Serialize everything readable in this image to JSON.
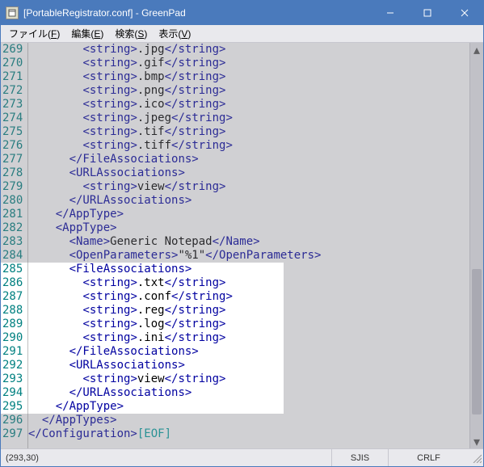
{
  "window": {
    "title": "[PortableRegistrator.conf] - GreenPad"
  },
  "menu": {
    "file": "ファイル(F)",
    "edit": "編集(E)",
    "search": "検索(S)",
    "view": "表示(V)"
  },
  "status": {
    "pos": "(293,30)",
    "encoding": "SJIS",
    "eol": "CRLF"
  },
  "highlight": {
    "startLine": 285,
    "endLine": 295
  },
  "lines": [
    {
      "n": 269,
      "indent": 8,
      "pre": "<string>",
      "mid": ".jpg",
      "post": "</string>"
    },
    {
      "n": 270,
      "indent": 8,
      "pre": "<string>",
      "mid": ".gif",
      "post": "</string>"
    },
    {
      "n": 271,
      "indent": 8,
      "pre": "<string>",
      "mid": ".bmp",
      "post": "</string>"
    },
    {
      "n": 272,
      "indent": 8,
      "pre": "<string>",
      "mid": ".png",
      "post": "</string>"
    },
    {
      "n": 273,
      "indent": 8,
      "pre": "<string>",
      "mid": ".ico",
      "post": "</string>"
    },
    {
      "n": 274,
      "indent": 8,
      "pre": "<string>",
      "mid": ".jpeg",
      "post": "</string>"
    },
    {
      "n": 275,
      "indent": 8,
      "pre": "<string>",
      "mid": ".tif",
      "post": "</string>"
    },
    {
      "n": 276,
      "indent": 8,
      "pre": "<string>",
      "mid": ".tiff",
      "post": "</string>"
    },
    {
      "n": 277,
      "indent": 6,
      "pre": "</FileAssociations>",
      "mid": "",
      "post": ""
    },
    {
      "n": 278,
      "indent": 6,
      "pre": "<URLAssociations>",
      "mid": "",
      "post": ""
    },
    {
      "n": 279,
      "indent": 8,
      "pre": "<string>",
      "mid": "view",
      "post": "</string>"
    },
    {
      "n": 280,
      "indent": 6,
      "pre": "</URLAssociations>",
      "mid": "",
      "post": ""
    },
    {
      "n": 281,
      "indent": 4,
      "pre": "</AppType>",
      "mid": "",
      "post": ""
    },
    {
      "n": 282,
      "indent": 4,
      "pre": "<AppType>",
      "mid": "",
      "post": ""
    },
    {
      "n": 283,
      "indent": 6,
      "pre": "<Name>",
      "mid": "Generic Notepad",
      "post": "</Name>"
    },
    {
      "n": 284,
      "indent": 6,
      "pre": "<OpenParameters>",
      "mid": "\"%1\"",
      "post": "</OpenParameters>"
    },
    {
      "n": 285,
      "indent": 6,
      "pre": "<FileAssociations>",
      "mid": "",
      "post": ""
    },
    {
      "n": 286,
      "indent": 8,
      "pre": "<string>",
      "mid": ".txt",
      "post": "</string>"
    },
    {
      "n": 287,
      "indent": 8,
      "pre": "<string>",
      "mid": ".conf",
      "post": "</string>"
    },
    {
      "n": 288,
      "indent": 8,
      "pre": "<string>",
      "mid": ".reg",
      "post": "</string>"
    },
    {
      "n": 289,
      "indent": 8,
      "pre": "<string>",
      "mid": ".log",
      "post": "</string>"
    },
    {
      "n": 290,
      "indent": 8,
      "pre": "<string>",
      "mid": ".ini",
      "post": "</string>"
    },
    {
      "n": 291,
      "indent": 6,
      "pre": "</FileAssociations>",
      "mid": "",
      "post": ""
    },
    {
      "n": 292,
      "indent": 6,
      "pre": "<URLAssociations>",
      "mid": "",
      "post": ""
    },
    {
      "n": 293,
      "indent": 8,
      "pre": "<string>",
      "mid": "view",
      "post": "</string>"
    },
    {
      "n": 294,
      "indent": 6,
      "pre": "</URLAssociations>",
      "mid": "",
      "post": ""
    },
    {
      "n": 295,
      "indent": 4,
      "pre": "</AppType>",
      "mid": "",
      "post": ""
    },
    {
      "n": 296,
      "indent": 2,
      "pre": "</AppTypes>",
      "mid": "",
      "post": ""
    },
    {
      "n": 297,
      "indent": 0,
      "pre": "</Configuration>",
      "mid": "",
      "post": "",
      "eof": "[EOF]"
    }
  ]
}
